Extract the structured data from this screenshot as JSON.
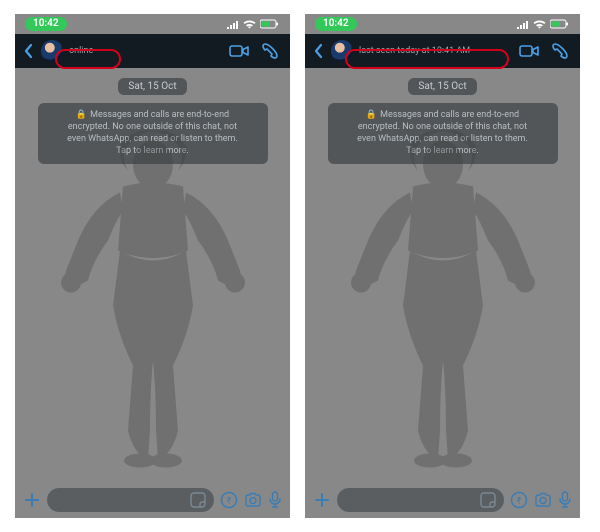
{
  "statusbar": {
    "time": "10:42"
  },
  "header": {
    "status_online": "online",
    "status_lastseen": "last seen today at 10:41 AM"
  },
  "body": {
    "date_label": "Sat, 15 Oct",
    "encryption_line1": "Messages and calls are end-to-end",
    "encryption_line2": "encrypted. No one outside of this chat, not",
    "encryption_line3": "even WhatsApp, can read or listen to them.",
    "encryption_line4": "Tap to learn more."
  }
}
